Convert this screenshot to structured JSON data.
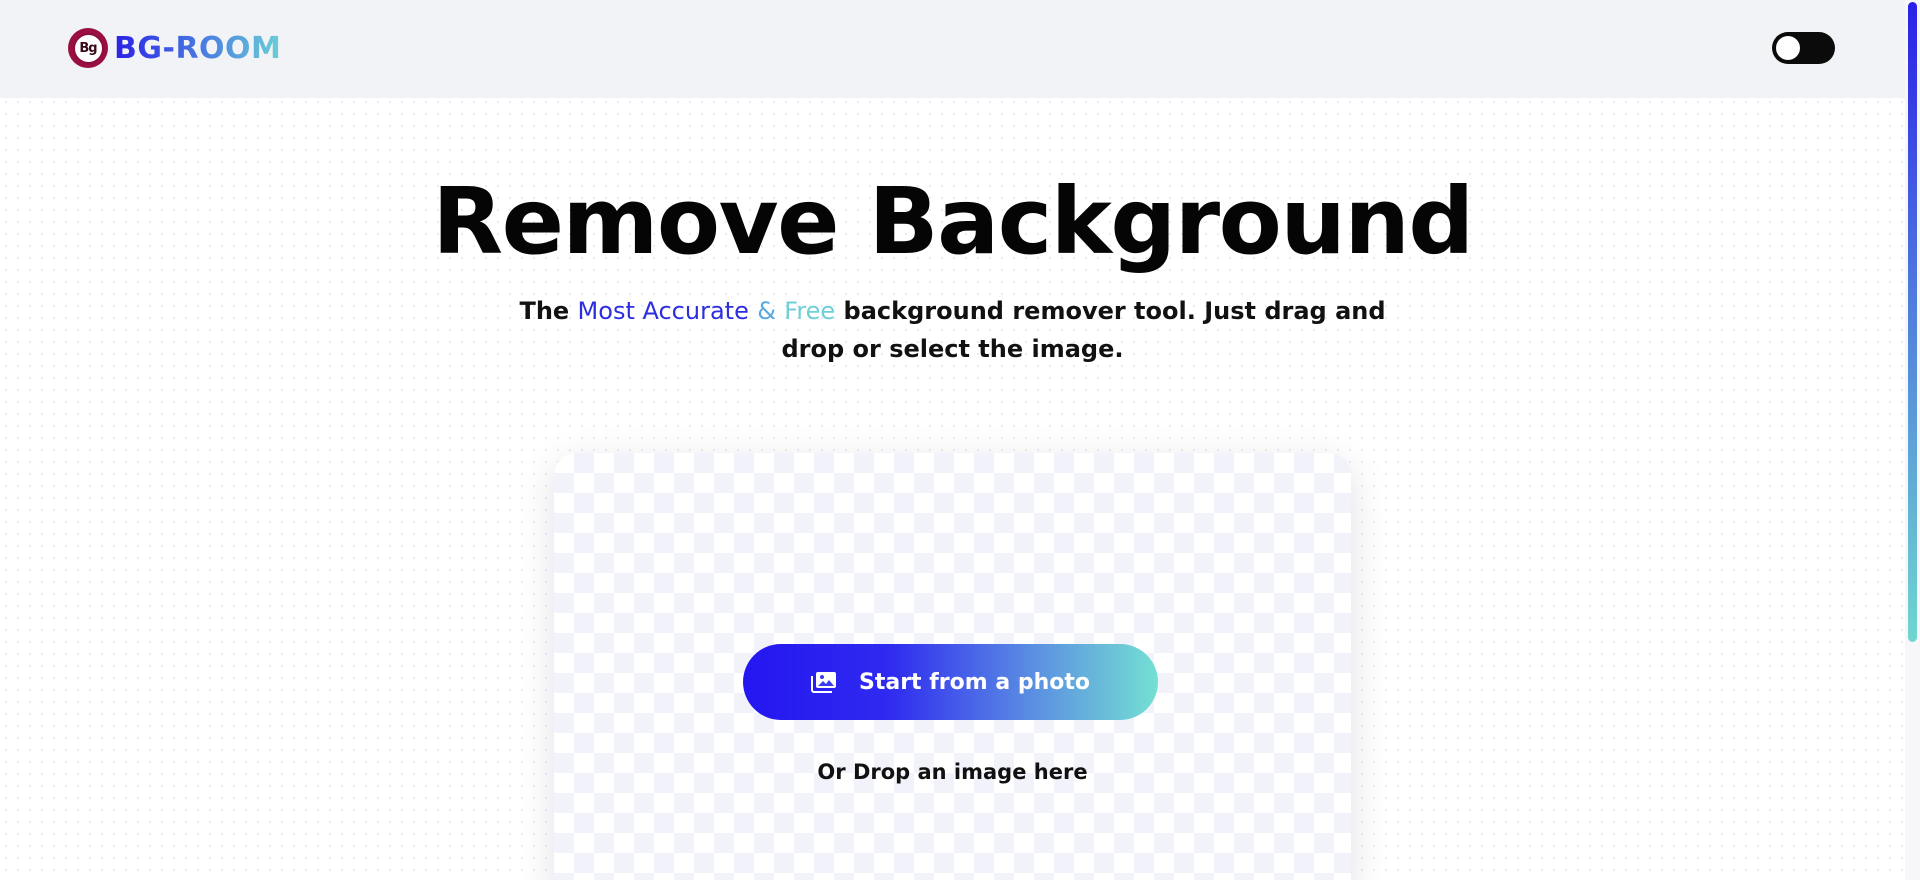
{
  "header": {
    "logo_badge": "Bg",
    "logo_text": "BG-ROOM"
  },
  "theme_toggle": {
    "state": "off"
  },
  "hero": {
    "title": "Remove Background",
    "subtitle": {
      "prefix": "The ",
      "highlight_1": "Most Accurate",
      "highlight_2": "&",
      "highlight_3": "Free",
      "suffix": " background remover tool. Just drag and drop or select the image."
    }
  },
  "upload": {
    "button_label": "Start from a photo",
    "button_icon": "image-gallery-icon",
    "drop_text": "Or Drop an image here"
  },
  "colors": {
    "brand_gradient_start": "#2416f0",
    "brand_gradient_end": "#74e0d2",
    "logo_badge": "#8c0d3c",
    "header_bg": "#f2f3f7"
  }
}
